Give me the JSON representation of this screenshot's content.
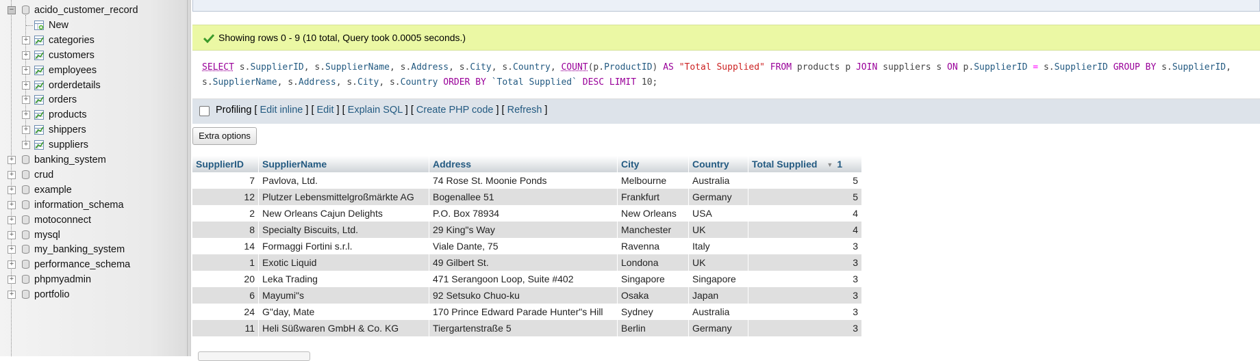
{
  "nav": {
    "root_db": "acido_customer_record",
    "new_label": "New",
    "tables": [
      "categories",
      "customers",
      "employees",
      "orderdetails",
      "orders",
      "products",
      "shippers",
      "suppliers"
    ],
    "databases": [
      "banking_system",
      "crud",
      "example",
      "information_schema",
      "motoconnect",
      "mysql",
      "my_banking_system",
      "performance_schema",
      "phpmyadmin",
      "portfolio"
    ]
  },
  "status": {
    "message": "Showing rows 0 - 9 (10 total, Query took 0.0005 seconds.)"
  },
  "toolbar": {
    "profiling": "Profiling",
    "edit_inline": "Edit inline",
    "edit": "Edit",
    "explain": "Explain SQL",
    "create_php": "Create PHP code",
    "refresh": "Refresh"
  },
  "extra_options": "Extra options",
  "results": {
    "columns": [
      "SupplierID",
      "SupplierName",
      "Address",
      "City",
      "Country",
      "Total Supplied"
    ],
    "sort_index": "1",
    "rows": [
      [
        "7",
        "Pavlova, Ltd.",
        "74 Rose St. Moonie Ponds",
        "Melbourne",
        "Australia",
        "5"
      ],
      [
        "12",
        "Plutzer Lebensmittelgroßmärkte AG",
        "Bogenallee 51",
        "Frankfurt",
        "Germany",
        "5"
      ],
      [
        "2",
        "New Orleans Cajun Delights",
        "P.O. Box 78934",
        "New Orleans",
        "USA",
        "4"
      ],
      [
        "8",
        "Specialty Biscuits, Ltd.",
        "29 King\"s Way",
        "Manchester",
        "UK",
        "4"
      ],
      [
        "14",
        "Formaggi Fortini s.r.l.",
        "Viale Dante, 75",
        "Ravenna",
        "Italy",
        "3"
      ],
      [
        "1",
        "Exotic Liquid",
        "49 Gilbert St.",
        "Londona",
        "UK",
        "3"
      ],
      [
        "20",
        "Leka Trading",
        "471 Serangoon Loop, Suite #402",
        "Singapore",
        "Singapore",
        "3"
      ],
      [
        "6",
        "Mayumi\"s",
        "92 Setsuko Chuo-ku",
        "Osaka",
        "Japan",
        "3"
      ],
      [
        "24",
        "G\"day, Mate",
        "170 Prince Edward Parade Hunter\"s Hill",
        "Sydney",
        "Australia",
        "3"
      ],
      [
        "11",
        "Heli Süßwaren GmbH & Co. KG",
        "Tiergartenstraße 5",
        "Berlin",
        "Germany",
        "3"
      ]
    ]
  },
  "icons": {
    "check": "check-icon",
    "database": "database-icon",
    "table": "table-icon",
    "new": "new-icon"
  }
}
